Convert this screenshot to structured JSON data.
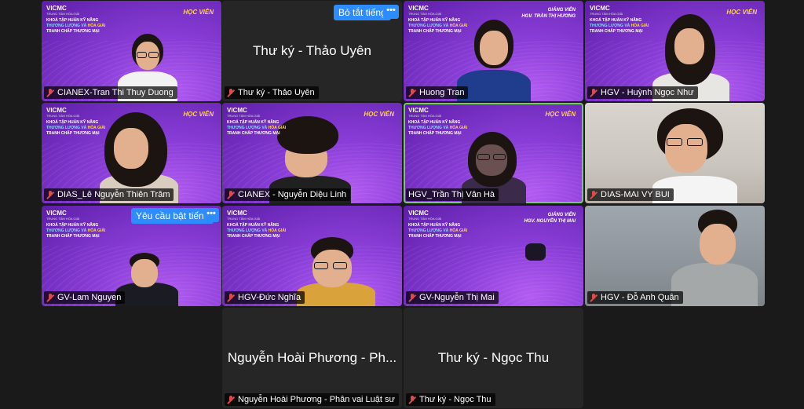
{
  "brand": {
    "logo": "VICMC",
    "logo_sub": "TRUNG TÂM HÒA GIẢI",
    "course_line1": "KHOÁ TẬP HUẤN KỸ NĂNG",
    "course_line2a": "THƯƠNG LƯỢNG VÀ ",
    "course_line2b": "HÒA GIẢI",
    "course_line3": "TRANH CHẤP THƯƠNG MẠI",
    "badge_student": "HỌC VIÊN",
    "teacher_role": "GIẢNG VIÊN",
    "teacher_name_1": "HGV. TRẦN THỊ HƯƠNG",
    "teacher_name_2": "HGV. NGUYỄN THỊ MAI"
  },
  "controls": {
    "mute_all": "Bỏ tắt tiếng",
    "ask_unmute": "Yêu cầu bật tiếng",
    "more": "•••"
  },
  "participants": [
    {
      "name": "CIANEX-Tran Thi Thuy Duong"
    },
    {
      "name": "Thư ký - Thảo Uyên",
      "display": "Thư ký - Thảo Uyên"
    },
    {
      "name": "Huong Tran"
    },
    {
      "name": "HGV - Huỳnh Ngọc Như"
    },
    {
      "name": "DIAS_Lê Nguyễn Thiên Trâm"
    },
    {
      "name": "CIANEX - Nguyễn Diệu Linh"
    },
    {
      "name": "HGV_Trần Thị Vân Hà"
    },
    {
      "name": "DIAS-MAI VY BUI"
    },
    {
      "name": "GV-Lam Nguyen"
    },
    {
      "name": "HGV-Đức Nghĩa"
    },
    {
      "name": "GV-Nguyễn Thị Mai"
    },
    {
      "name": "HGV - Đỗ Anh Quân"
    },
    {
      "name": "Nguyễn Hoài Phương - Phân vai Luật sư",
      "display": "Nguyễn Hoài Phương - Ph..."
    },
    {
      "name": "Thư ký - Ngọc Thu",
      "display": "Thư ký - Ngọc Thu"
    }
  ]
}
